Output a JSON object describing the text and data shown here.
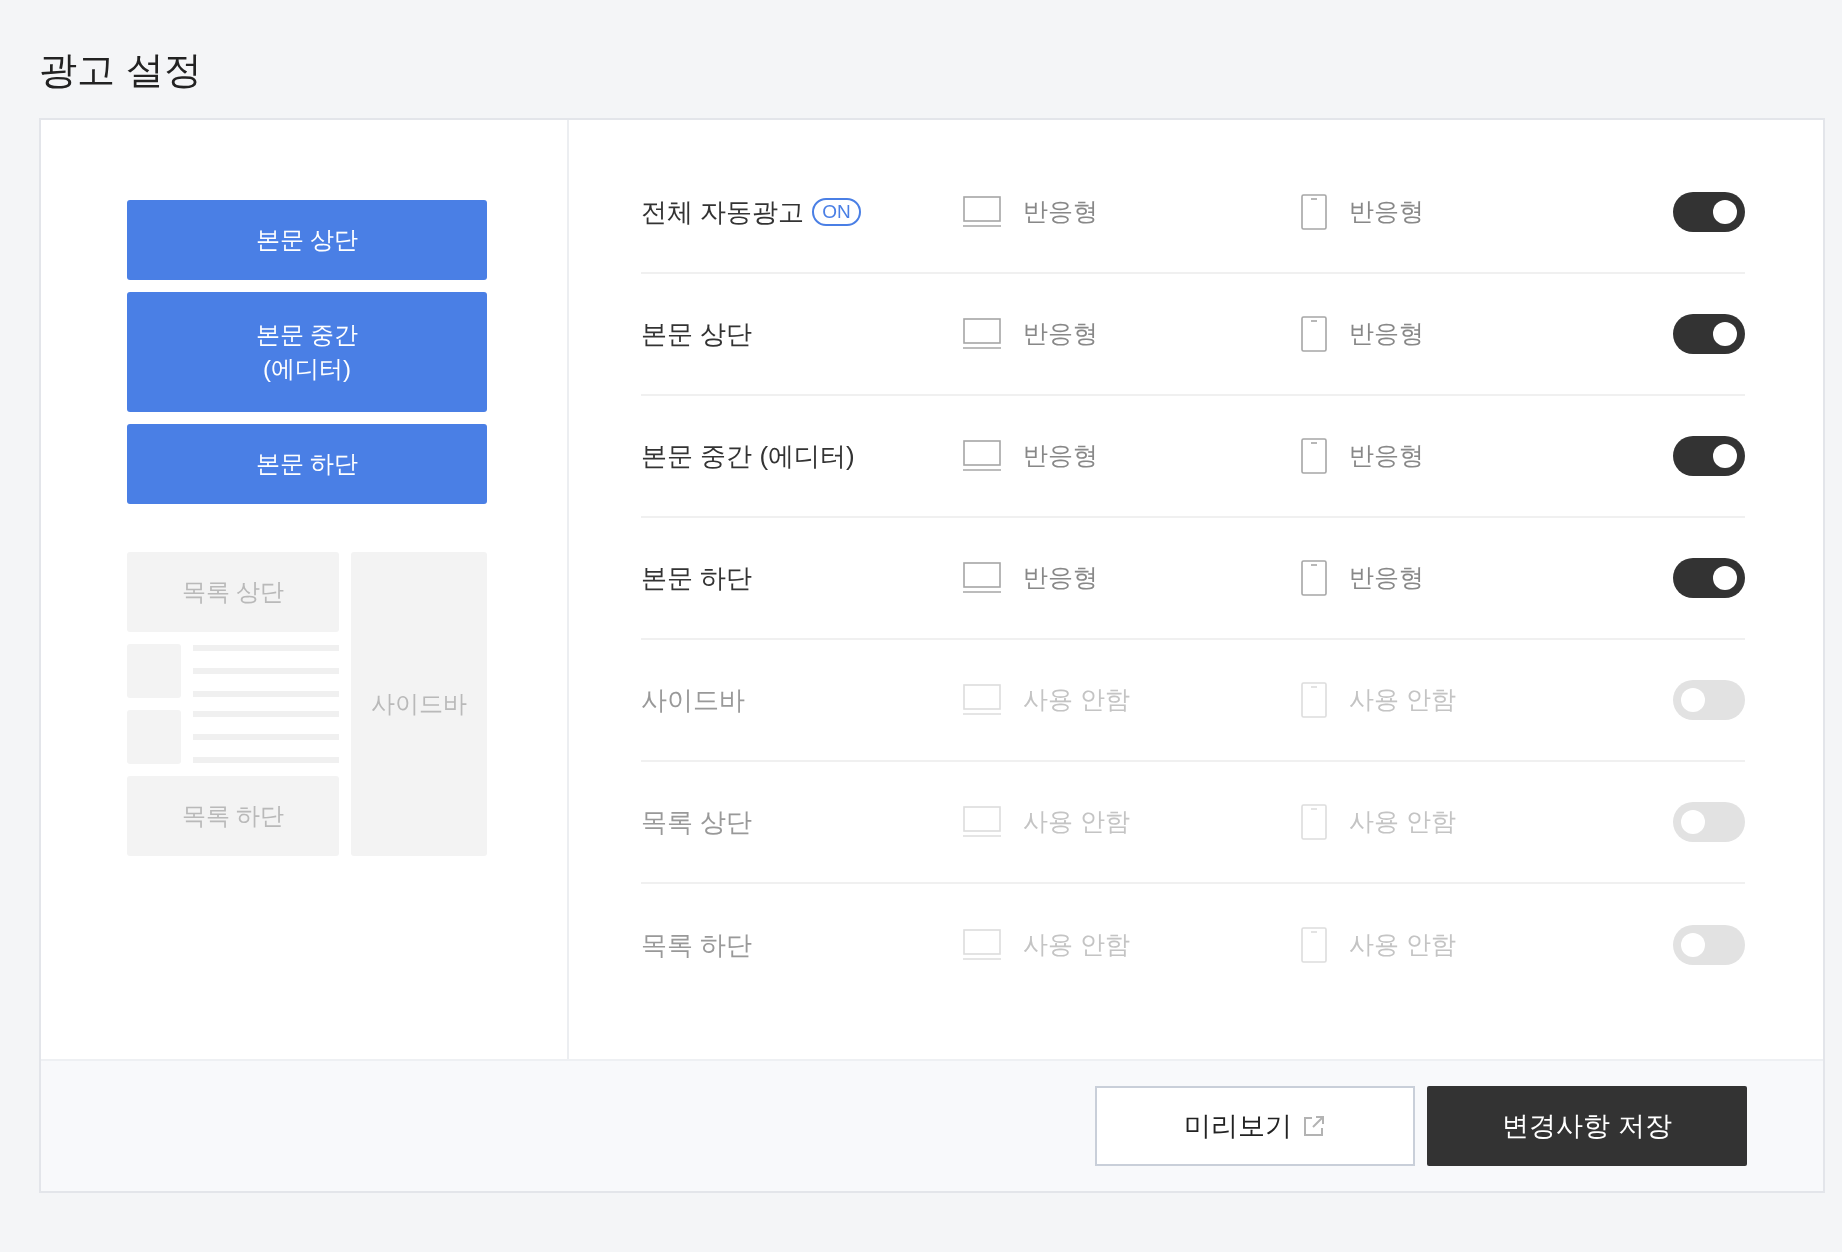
{
  "title": "광고 설정",
  "preview": {
    "main_blocks": [
      {
        "label": "본문 상단",
        "active": true
      },
      {
        "label": "본문 중간\n(에디터)",
        "active": true
      },
      {
        "label": "본문 하단",
        "active": true
      }
    ],
    "list_top": {
      "label": "목록 상단",
      "active": false
    },
    "list_bottom": {
      "label": "목록 하단",
      "active": false
    },
    "sidebar": {
      "label": "사이드바",
      "active": false
    }
  },
  "rows": [
    {
      "label": "전체 자동광고",
      "badge": "ON",
      "on": true,
      "desktop": "반응형",
      "mobile": "반응형"
    },
    {
      "label": "본문 상단",
      "on": true,
      "desktop": "반응형",
      "mobile": "반응형"
    },
    {
      "label": "본문 중간 (에디터)",
      "on": true,
      "desktop": "반응형",
      "mobile": "반응형"
    },
    {
      "label": "본문 하단",
      "on": true,
      "desktop": "반응형",
      "mobile": "반응형"
    },
    {
      "label": "사이드바",
      "on": false,
      "desktop": "사용 안함",
      "mobile": "사용 안함"
    },
    {
      "label": "목록 상단",
      "on": false,
      "desktop": "사용 안함",
      "mobile": "사용 안함"
    },
    {
      "label": "목록 하단",
      "on": false,
      "desktop": "사용 안함",
      "mobile": "사용 안함"
    }
  ],
  "buttons": {
    "preview": "미리보기",
    "save": "변경사항 저장"
  }
}
